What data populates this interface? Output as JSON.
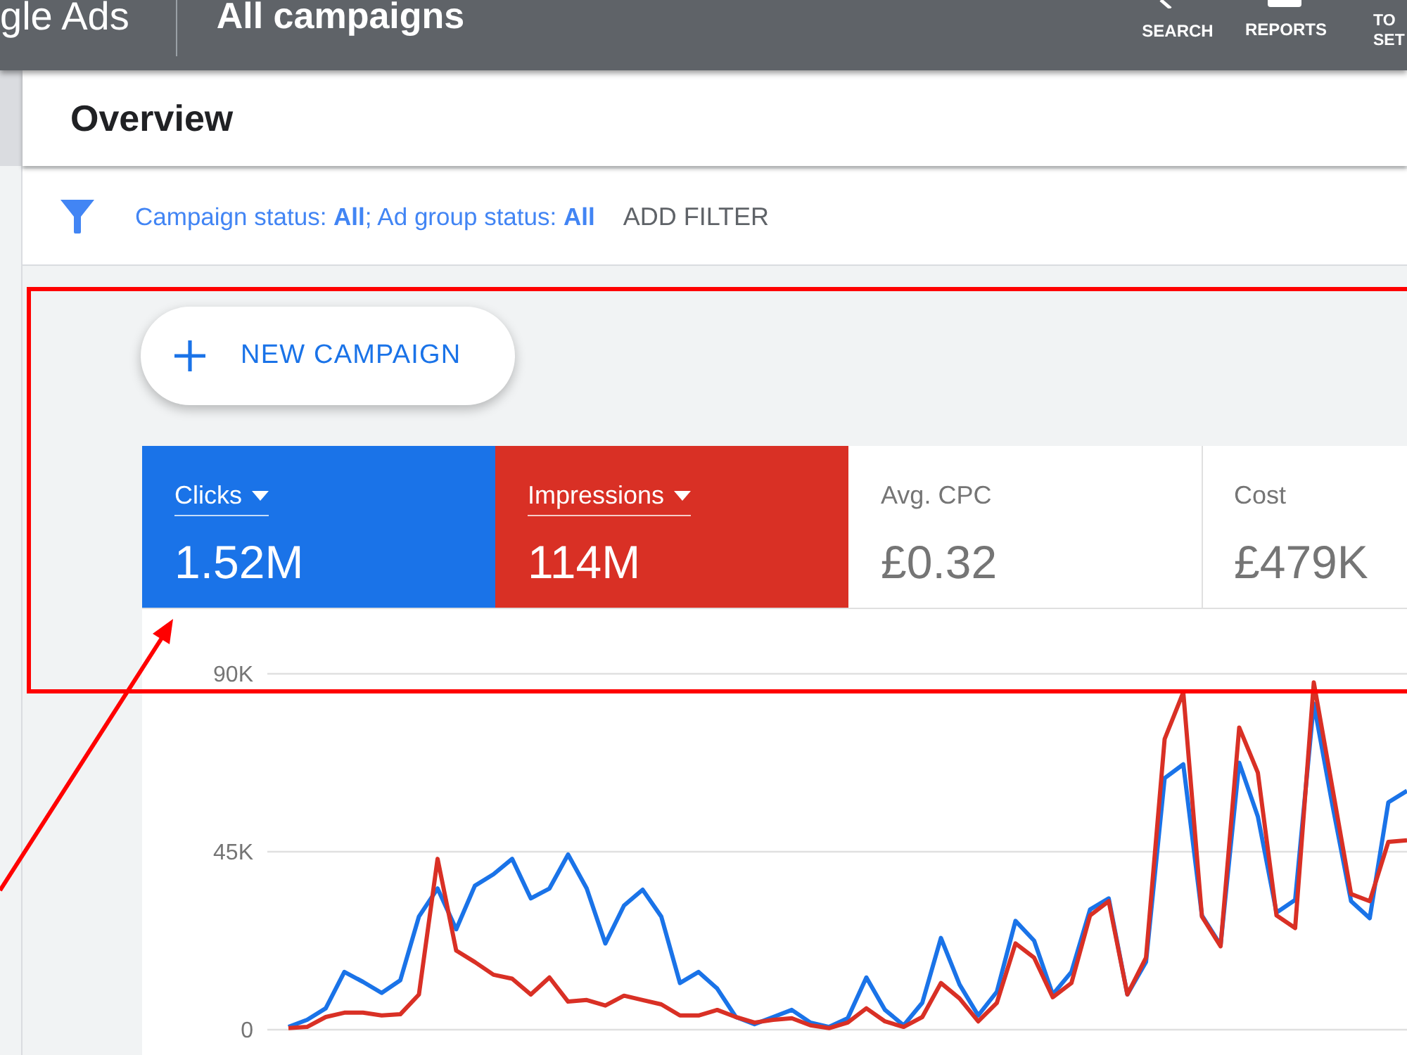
{
  "top_bar": {
    "logo_text": "gle Ads",
    "title": "All campaigns",
    "nav": [
      {
        "kind": "search",
        "label_lines": [
          "SEARCH"
        ]
      },
      {
        "kind": "reports",
        "label_lines": [
          "REPORTS"
        ]
      },
      {
        "kind": "text",
        "label_lines": [
          "TO",
          "SET"
        ]
      }
    ]
  },
  "page_title": "Overview",
  "filter_bar": {
    "summary": "Campaign status: **All**; Ad group status: **All**",
    "add_filter": "ADD FILTER"
  },
  "new_campaign_button": {
    "label": "NEW CAMPAIGN"
  },
  "metrics": [
    {
      "label": "Clicks",
      "value": "1.52M",
      "selected": true,
      "color": "#1a73e8"
    },
    {
      "label": "Impressions",
      "value": "114M",
      "selected": true,
      "color": "#d93025"
    },
    {
      "label": "Avg. CPC",
      "value": "£0.32",
      "selected": false
    },
    {
      "label": "Cost",
      "value": "£479K",
      "selected": false
    }
  ],
  "chart": {
    "chart_data": {
      "type": "line",
      "ylim": [
        0,
        90000
      ],
      "yticks": [
        {
          "value": 0,
          "label": "0"
        },
        {
          "value": 45000,
          "label": "45K"
        },
        {
          "value": 90000,
          "label": "90K"
        }
      ],
      "series": [
        {
          "color": "#1a73e8",
          "values": [
            700,
            2500,
            5400,
            14600,
            12100,
            9300,
            12500,
            28600,
            35700,
            25400,
            36400,
            39300,
            43200,
            33200,
            35700,
            44300,
            35700,
            21800,
            31400,
            35400,
            28600,
            11800,
            14600,
            10400,
            3200,
            1400,
            3200,
            5000,
            1800,
            700,
            2900,
            13200,
            5000,
            1100,
            6800,
            23200,
            11400,
            3600,
            9600,
            27500,
            22500,
            8900,
            14600,
            30400,
            33200,
            8900,
            17100,
            63600,
            67100,
            28900,
            21400,
            67500,
            53900,
            29600,
            32800,
            82500,
            56800,
            32500,
            28200,
            57500,
            60400
          ]
        },
        {
          "color": "#d93025",
          "values": [
            400,
            700,
            3200,
            4300,
            4300,
            3600,
            3900,
            8900,
            43200,
            20000,
            17100,
            13900,
            12900,
            8900,
            13200,
            7100,
            7500,
            6100,
            8600,
            7500,
            6400,
            3600,
            3600,
            5000,
            3200,
            1800,
            2500,
            2900,
            1100,
            400,
            1800,
            5400,
            2100,
            700,
            3200,
            11800,
            7900,
            2100,
            6800,
            21800,
            18200,
            8200,
            11800,
            28900,
            32500,
            8900,
            18200,
            73500,
            85300,
            28600,
            21100,
            76400,
            65000,
            28900,
            25700,
            87800,
            61100,
            34300,
            32500,
            47500,
            47900
          ]
        }
      ]
    }
  }
}
